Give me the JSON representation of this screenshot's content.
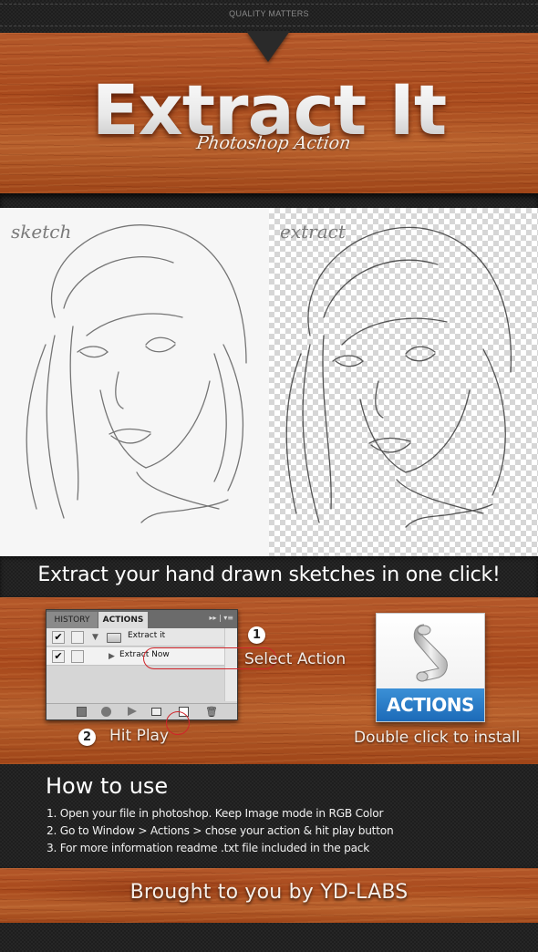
{
  "banner": {
    "tagline_top": "QUALITY MATTERS",
    "title": "Extract It",
    "subtitle": "Photoshop Action"
  },
  "comparison": {
    "left_label": "sketch",
    "right_label": "extract"
  },
  "headline": "Extract your hand drawn sketches in one click!",
  "panel": {
    "tabs": [
      {
        "label": "HISTORY",
        "active": false
      },
      {
        "label": "ACTIONS",
        "active": true
      }
    ],
    "menu_glyph": "▸▸ | ▾≡",
    "rows": [
      {
        "checked": true,
        "type": "set",
        "label": "Extract it",
        "expanded": true
      },
      {
        "checked": true,
        "type": "action",
        "label": "Extract Now",
        "highlighted": true
      }
    ],
    "footer_buttons": [
      "stop-icon",
      "record-icon",
      "play-icon",
      "new-set-icon",
      "new-action-icon",
      "trash-icon"
    ],
    "highlight_color": "#d0242a"
  },
  "steps": [
    {
      "number": "1",
      "label": "Select Action"
    },
    {
      "number": "2",
      "label": "Hit Play"
    }
  ],
  "install": {
    "icon_label": "ACTIONS",
    "caption": "Double click to install",
    "accent": "#2479c6"
  },
  "howto": {
    "title": "How to use",
    "items": [
      "1. Open your file in photoshop. Keep Image mode in RGB Color",
      "2. Go to Window > Actions > chose your action & hit play button",
      "3. For more information readme .txt file included in the pack"
    ]
  },
  "credits": "Brought to you by YD-LABS"
}
